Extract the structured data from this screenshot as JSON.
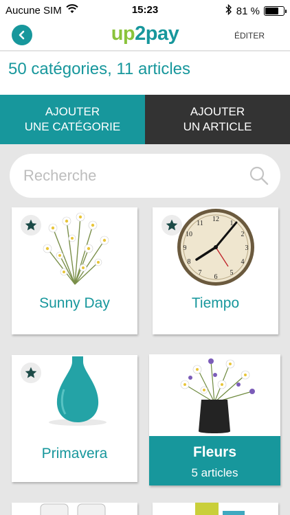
{
  "status_bar": {
    "carrier": "Aucune SIM",
    "time": "15:23",
    "battery_text": "81 %",
    "battery_level": 0.81
  },
  "header": {
    "logo_part1": "up",
    "logo_part2": "2pay",
    "edit_label": "ÉDITER",
    "colors": {
      "accent": "#17979c",
      "logo_green": "#8ac33b"
    }
  },
  "summary": {
    "text": "50 catégories, 11 articles"
  },
  "actions": {
    "add_category_line1": "AJOUTER",
    "add_category_line2": "UNE CATÉGORIE",
    "add_article_line1": "AJOUTER",
    "add_article_line2": "UN ARTICLE"
  },
  "search": {
    "placeholder": "Recherche",
    "value": ""
  },
  "categories": [
    {
      "label": "Sunny Day",
      "favorite": true,
      "image": "daisy-flowers"
    },
    {
      "label": "Tiempo",
      "favorite": true,
      "image": "wall-clock"
    },
    {
      "label": "Primavera",
      "favorite": true,
      "image": "teal-vase"
    },
    {
      "label": "Fleurs",
      "favorite": false,
      "image": "flower-vase",
      "selected": true,
      "count": "5 articles"
    }
  ]
}
